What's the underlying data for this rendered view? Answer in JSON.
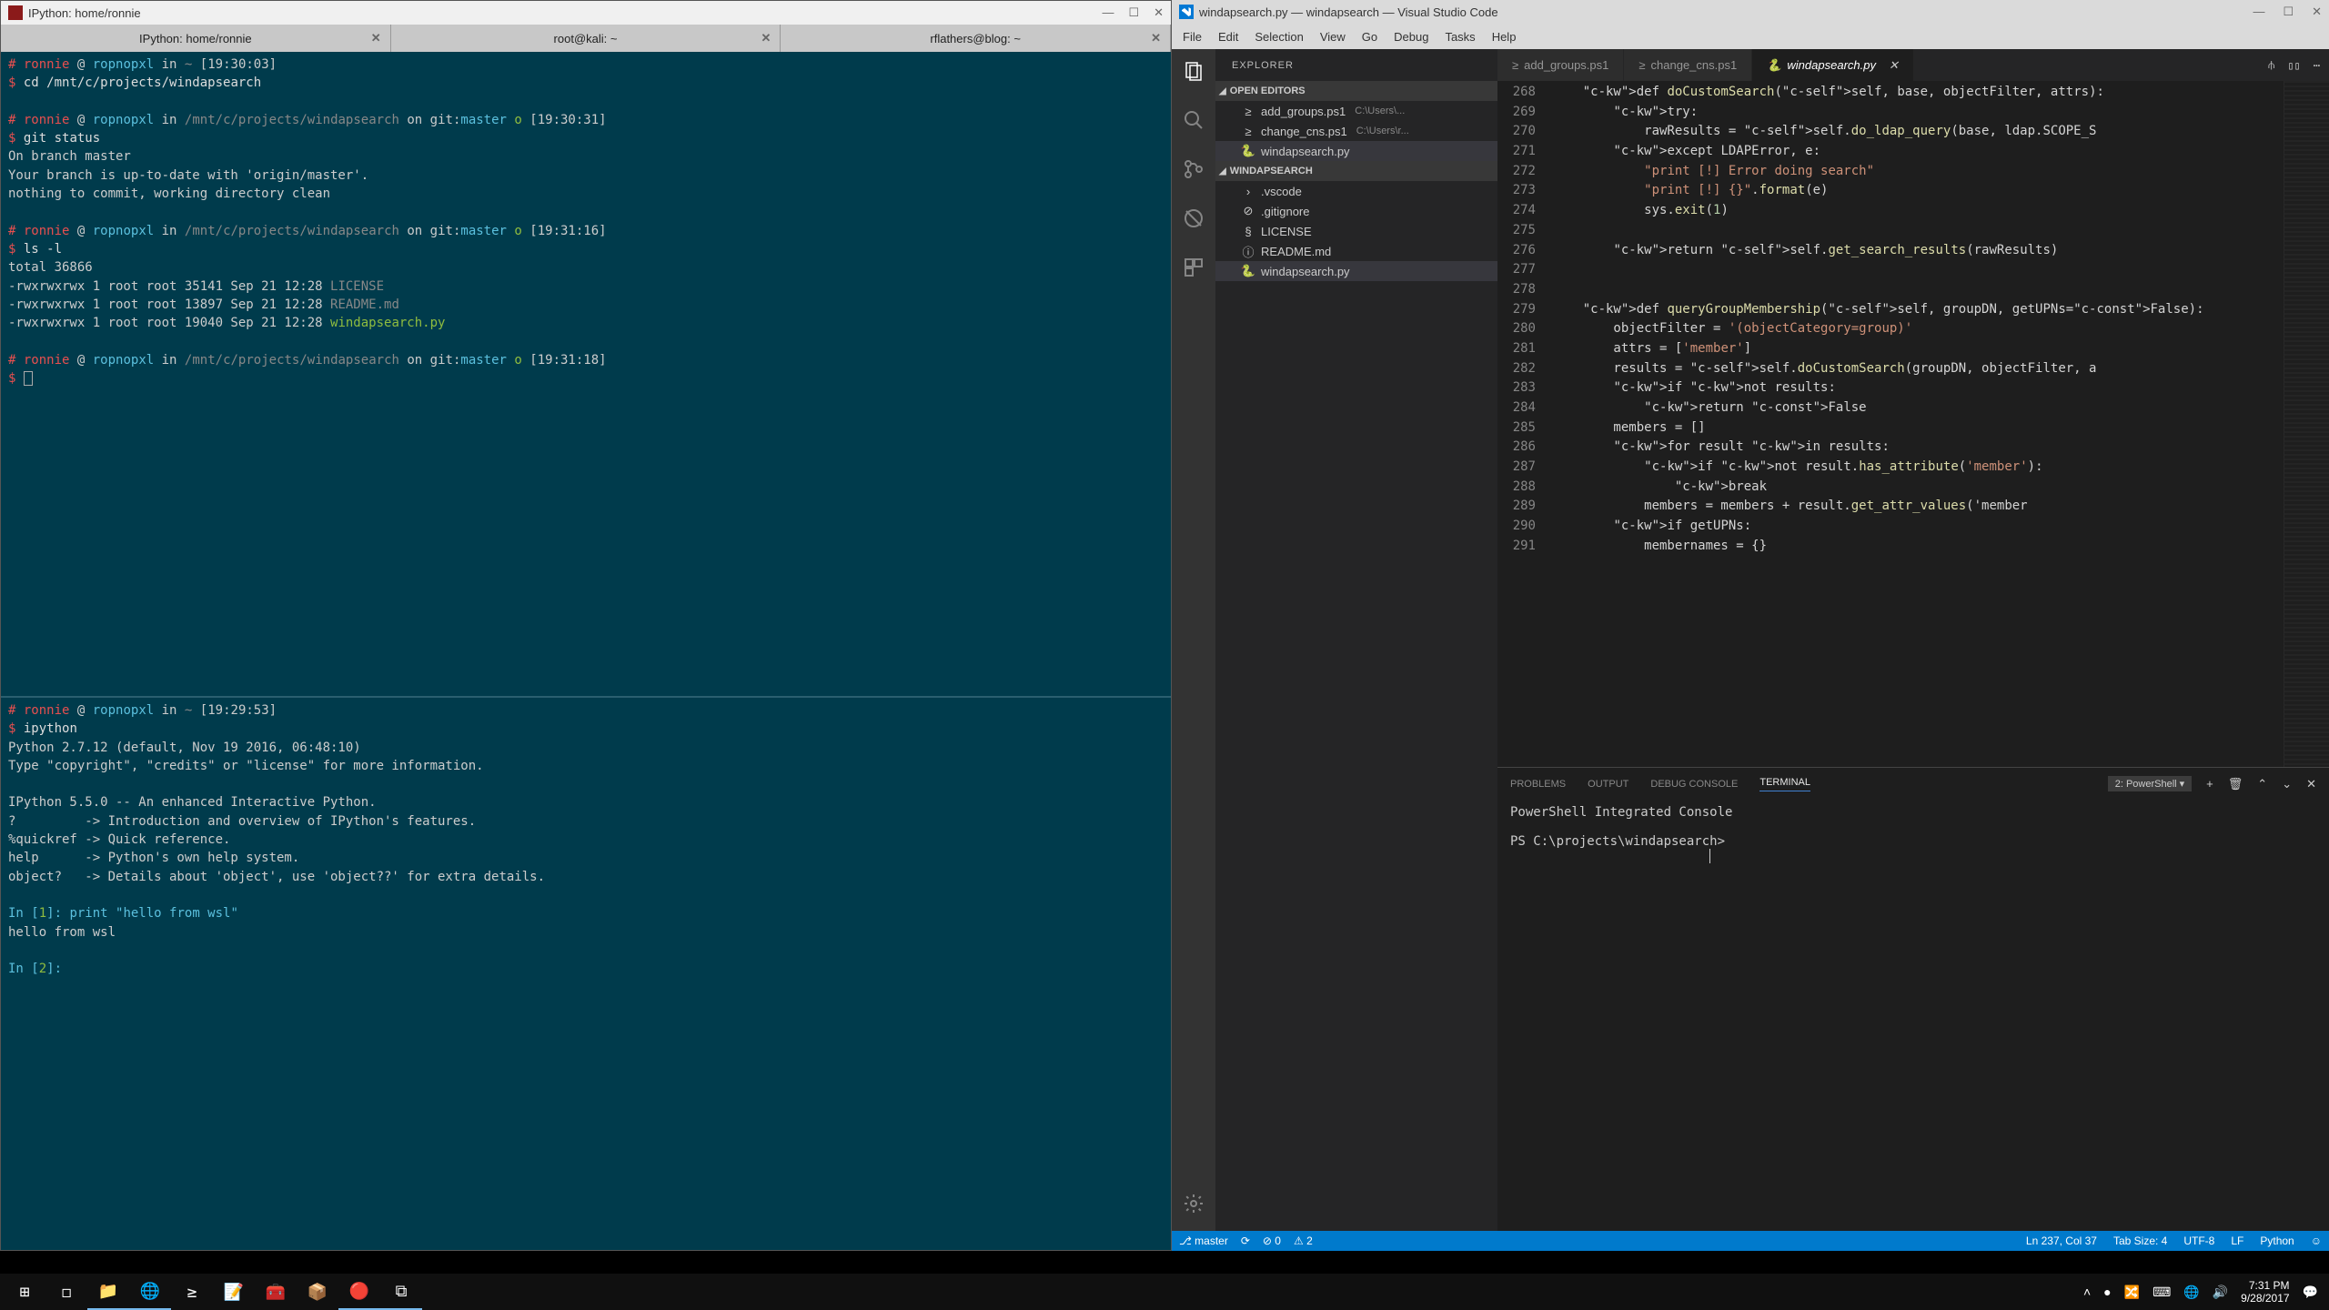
{
  "terminal": {
    "titlebar": "IPython: home/ronnie",
    "window_buttons": [
      "—",
      "☐",
      "✕"
    ],
    "tabs": [
      {
        "label": "IPython: home/ronnie"
      },
      {
        "label": "root@kali: ~"
      },
      {
        "label": "rflathers@blog: ~"
      }
    ],
    "pane_top": {
      "prompt_user": "ronnie",
      "prompt_host": "ropnopxl",
      "lines": [
        {
          "type": "prompt",
          "path": "~",
          "git": "",
          "time": "[19:30:03]"
        },
        {
          "type": "cmd",
          "text": "cd /mnt/c/projects/windapsearch"
        },
        {
          "type": "blank"
        },
        {
          "type": "prompt",
          "path": "/mnt/c/projects/windapsearch",
          "git": "master",
          "time": "[19:30:31]"
        },
        {
          "type": "cmd",
          "text": "git status"
        },
        {
          "type": "out",
          "text": "On branch master"
        },
        {
          "type": "out",
          "text": "Your branch is up-to-date with 'origin/master'."
        },
        {
          "type": "out",
          "text": "nothing to commit, working directory clean"
        },
        {
          "type": "blank"
        },
        {
          "type": "prompt",
          "path": "/mnt/c/projects/windapsearch",
          "git": "master",
          "time": "[19:31:16]"
        },
        {
          "type": "cmd",
          "text": "ls -l"
        },
        {
          "type": "out",
          "text": "total 36866"
        },
        {
          "type": "ls",
          "perm": "-rwxrwxrwx 1 root root 35141 Sep 21 12:28",
          "name": "LICENSE",
          "cls": "dim"
        },
        {
          "type": "ls",
          "perm": "-rwxrwxrwx 1 root root 13897 Sep 21 12:28",
          "name": "README.md",
          "cls": "dim"
        },
        {
          "type": "ls",
          "perm": "-rwxrwxrwx 1 root root 19040 Sep 21 12:28",
          "name": "windapsearch.py",
          "cls": "green"
        },
        {
          "type": "blank"
        },
        {
          "type": "prompt",
          "path": "/mnt/c/projects/windapsearch",
          "git": "master",
          "time": "[19:31:18]"
        },
        {
          "type": "cursor"
        }
      ]
    },
    "pane_bottom": {
      "lines": [
        {
          "type": "prompt",
          "path": "~",
          "git": "",
          "time": "[19:29:53]"
        },
        {
          "type": "cmd",
          "text": "ipython"
        },
        {
          "type": "out",
          "text": "Python 2.7.12 (default, Nov 19 2016, 06:48:10)"
        },
        {
          "type": "out",
          "text": "Type \"copyright\", \"credits\" or \"license\" for more information."
        },
        {
          "type": "blank"
        },
        {
          "type": "out",
          "text": "IPython 5.5.0 -- An enhanced Interactive Python."
        },
        {
          "type": "out",
          "text": "?         -> Introduction and overview of IPython's features."
        },
        {
          "type": "out",
          "text": "%quickref -> Quick reference."
        },
        {
          "type": "out",
          "text": "help      -> Python's own help system."
        },
        {
          "type": "out",
          "text": "object?   -> Details about 'object', use 'object??' for extra details."
        },
        {
          "type": "blank"
        },
        {
          "type": "ipy_in",
          "n": "1",
          "code": "print \"hello from wsl\""
        },
        {
          "type": "out",
          "text": "hello from wsl"
        },
        {
          "type": "blank"
        },
        {
          "type": "ipy_in",
          "n": "2",
          "code": ""
        }
      ]
    }
  },
  "vscode": {
    "titlebar": "windapsearch.py — windapsearch — Visual Studio Code",
    "window_buttons": [
      "—",
      "☐",
      "✕"
    ],
    "menu": [
      "File",
      "Edit",
      "Selection",
      "View",
      "Go",
      "Debug",
      "Tasks",
      "Help"
    ],
    "sidebar_title": "EXPLORER",
    "open_editors_label": "OPEN EDITORS",
    "folder_label": "WINDAPSEARCH",
    "open_editors": [
      {
        "icon": "≥",
        "name": "add_groups.ps1",
        "hint": "C:\\Users\\..."
      },
      {
        "icon": "≥",
        "name": "change_cns.ps1",
        "hint": "C:\\Users\\r..."
      },
      {
        "icon": "🐍",
        "name": "windapsearch.py",
        "hint": "",
        "active": true
      }
    ],
    "files": [
      {
        "icon": "›",
        "name": ".vscode",
        "kind": "folder"
      },
      {
        "icon": "⊘",
        "name": ".gitignore"
      },
      {
        "icon": "§",
        "name": "LICENSE"
      },
      {
        "icon": "ⓘ",
        "name": "README.md"
      },
      {
        "icon": "🐍",
        "name": "windapsearch.py",
        "active": true
      }
    ],
    "editor_tabs": [
      {
        "icon": "≥",
        "name": "add_groups.ps1"
      },
      {
        "icon": "≥",
        "name": "change_cns.ps1"
      },
      {
        "icon": "🐍",
        "name": "windapsearch.py",
        "active": true,
        "closeable": true
      }
    ],
    "tab_actions": [
      "⫛",
      "▯▯",
      "⋯"
    ],
    "code_start_line": 268,
    "code_lines": [
      "    def doCustomSearch(self, base, objectFilter, attrs):",
      "        try:",
      "            rawResults = self.do_ldap_query(base, ldap.SCOPE_S",
      "        except LDAPError, e:",
      "            \"print [!] Error doing search\"",
      "            \"print [!] {}\".format(e)",
      "            sys.exit(1)",
      "",
      "        return self.get_search_results(rawResults)",
      "",
      "",
      "    def queryGroupMembership(self, groupDN, getUPNs=False):",
      "        objectFilter = '(objectCategory=group)'",
      "        attrs = ['member']",
      "        results = self.doCustomSearch(groupDN, objectFilter, a",
      "        if not results:",
      "            return False",
      "        members = []",
      "        for result in results:",
      "            if not result.has_attribute('member'):",
      "                break",
      "            members = members + result.get_attr_values('member",
      "        if getUPNs:",
      "            membernames = {}"
    ],
    "panel": {
      "tabs": [
        "PROBLEMS",
        "OUTPUT",
        "DEBUG CONSOLE",
        "TERMINAL"
      ],
      "active_tab": "TERMINAL",
      "select_label": "2: PowerShell",
      "actions": [
        "+",
        "🗑",
        "⌃",
        "⌄",
        "✕"
      ],
      "body_line1": "PowerShell Integrated Console",
      "body_line2": "PS C:\\projects\\windapsearch>"
    },
    "statusbar": {
      "branch_icon": "⎇",
      "branch": "master",
      "sync_icon": "⟳",
      "errors": "⊘ 0",
      "warnings": "⚠ 2",
      "position": "Ln 237, Col 37",
      "tabsize": "Tab Size: 4",
      "encoding": "UTF-8",
      "eol": "LF",
      "language": "Python",
      "feedback": "☺"
    }
  },
  "taskbar": {
    "icons": [
      "⊞",
      "◻",
      "📁",
      "🌐",
      "≥",
      "📝",
      "🧰",
      "📦",
      "🔴",
      "⧉"
    ],
    "tray": [
      "˄",
      "●",
      "🔀",
      "⌨",
      "🌐",
      "🔊"
    ],
    "time": "7:31 PM",
    "date": "9/28/2017",
    "notif": "💬"
  }
}
